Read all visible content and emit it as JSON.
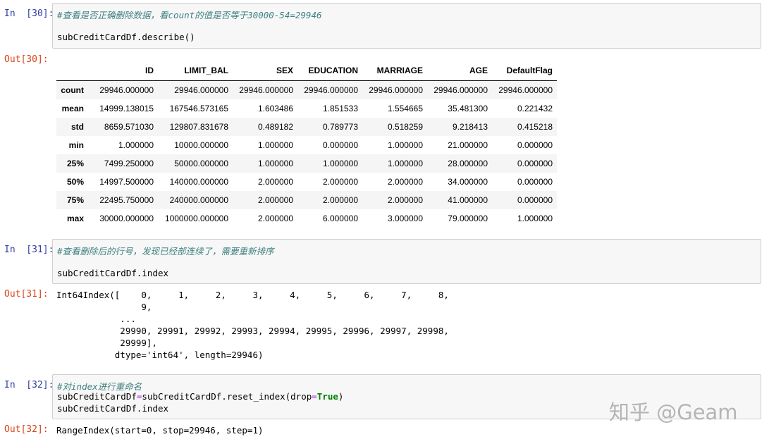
{
  "cells": [
    {
      "in_prompt": "In  [30]:",
      "comment": "#查看是否正确删除数据，看count的值是否等于30000-54=29946",
      "code": "subCreditCardDf.describe()",
      "out_prompt": "Out[30]:"
    },
    {
      "in_prompt": "In  [31]:",
      "comment": "#查看删除后的行号，发现已经部连续了，需要重新排序",
      "code": "subCreditCardDf.index",
      "out_prompt": "Out[31]:",
      "output": "Int64Index([    0,     1,     2,     3,     4,     5,     6,     7,     8,\n                9,\n            ...\n            29990, 29991, 29992, 29993, 29994, 29995, 29996, 29997, 29998,\n            29999],\n           dtype='int64', length=29946)"
    },
    {
      "in_prompt": "In  [32]:",
      "comment": "#对index进行重命名",
      "code_lhs": "subCreditCardDf",
      "code_op": "=",
      "code_rhs": "subCreditCardDf.reset_index(drop",
      "code_op2": "=",
      "code_kw": "True",
      "code_end": ")",
      "code2": "subCreditCardDf.index",
      "out_prompt": "Out[32]:",
      "output": "RangeIndex(start=0, stop=29946, step=1)"
    }
  ],
  "table": {
    "columns": [
      "",
      "ID",
      "LIMIT_BAL",
      "SEX",
      "EDUCATION",
      "MARRIAGE",
      "AGE",
      "DefaultFlag"
    ],
    "rows": [
      [
        "count",
        "29946.000000",
        "29946.000000",
        "29946.000000",
        "29946.000000",
        "29946.000000",
        "29946.000000",
        "29946.000000"
      ],
      [
        "mean",
        "14999.138015",
        "167546.573165",
        "1.603486",
        "1.851533",
        "1.554665",
        "35.481300",
        "0.221432"
      ],
      [
        "std",
        "8659.571030",
        "129807.831678",
        "0.489182",
        "0.789773",
        "0.518259",
        "9.218413",
        "0.415218"
      ],
      [
        "min",
        "1.000000",
        "10000.000000",
        "1.000000",
        "0.000000",
        "1.000000",
        "21.000000",
        "0.000000"
      ],
      [
        "25%",
        "7499.250000",
        "50000.000000",
        "1.000000",
        "1.000000",
        "1.000000",
        "28.000000",
        "0.000000"
      ],
      [
        "50%",
        "14997.500000",
        "140000.000000",
        "2.000000",
        "2.000000",
        "2.000000",
        "34.000000",
        "0.000000"
      ],
      [
        "75%",
        "22495.750000",
        "240000.000000",
        "2.000000",
        "2.000000",
        "2.000000",
        "41.000000",
        "0.000000"
      ],
      [
        "max",
        "30000.000000",
        "1000000.000000",
        "2.000000",
        "6.000000",
        "3.000000",
        "79.000000",
        "1.000000"
      ]
    ]
  },
  "watermark": "知乎 @Geam"
}
